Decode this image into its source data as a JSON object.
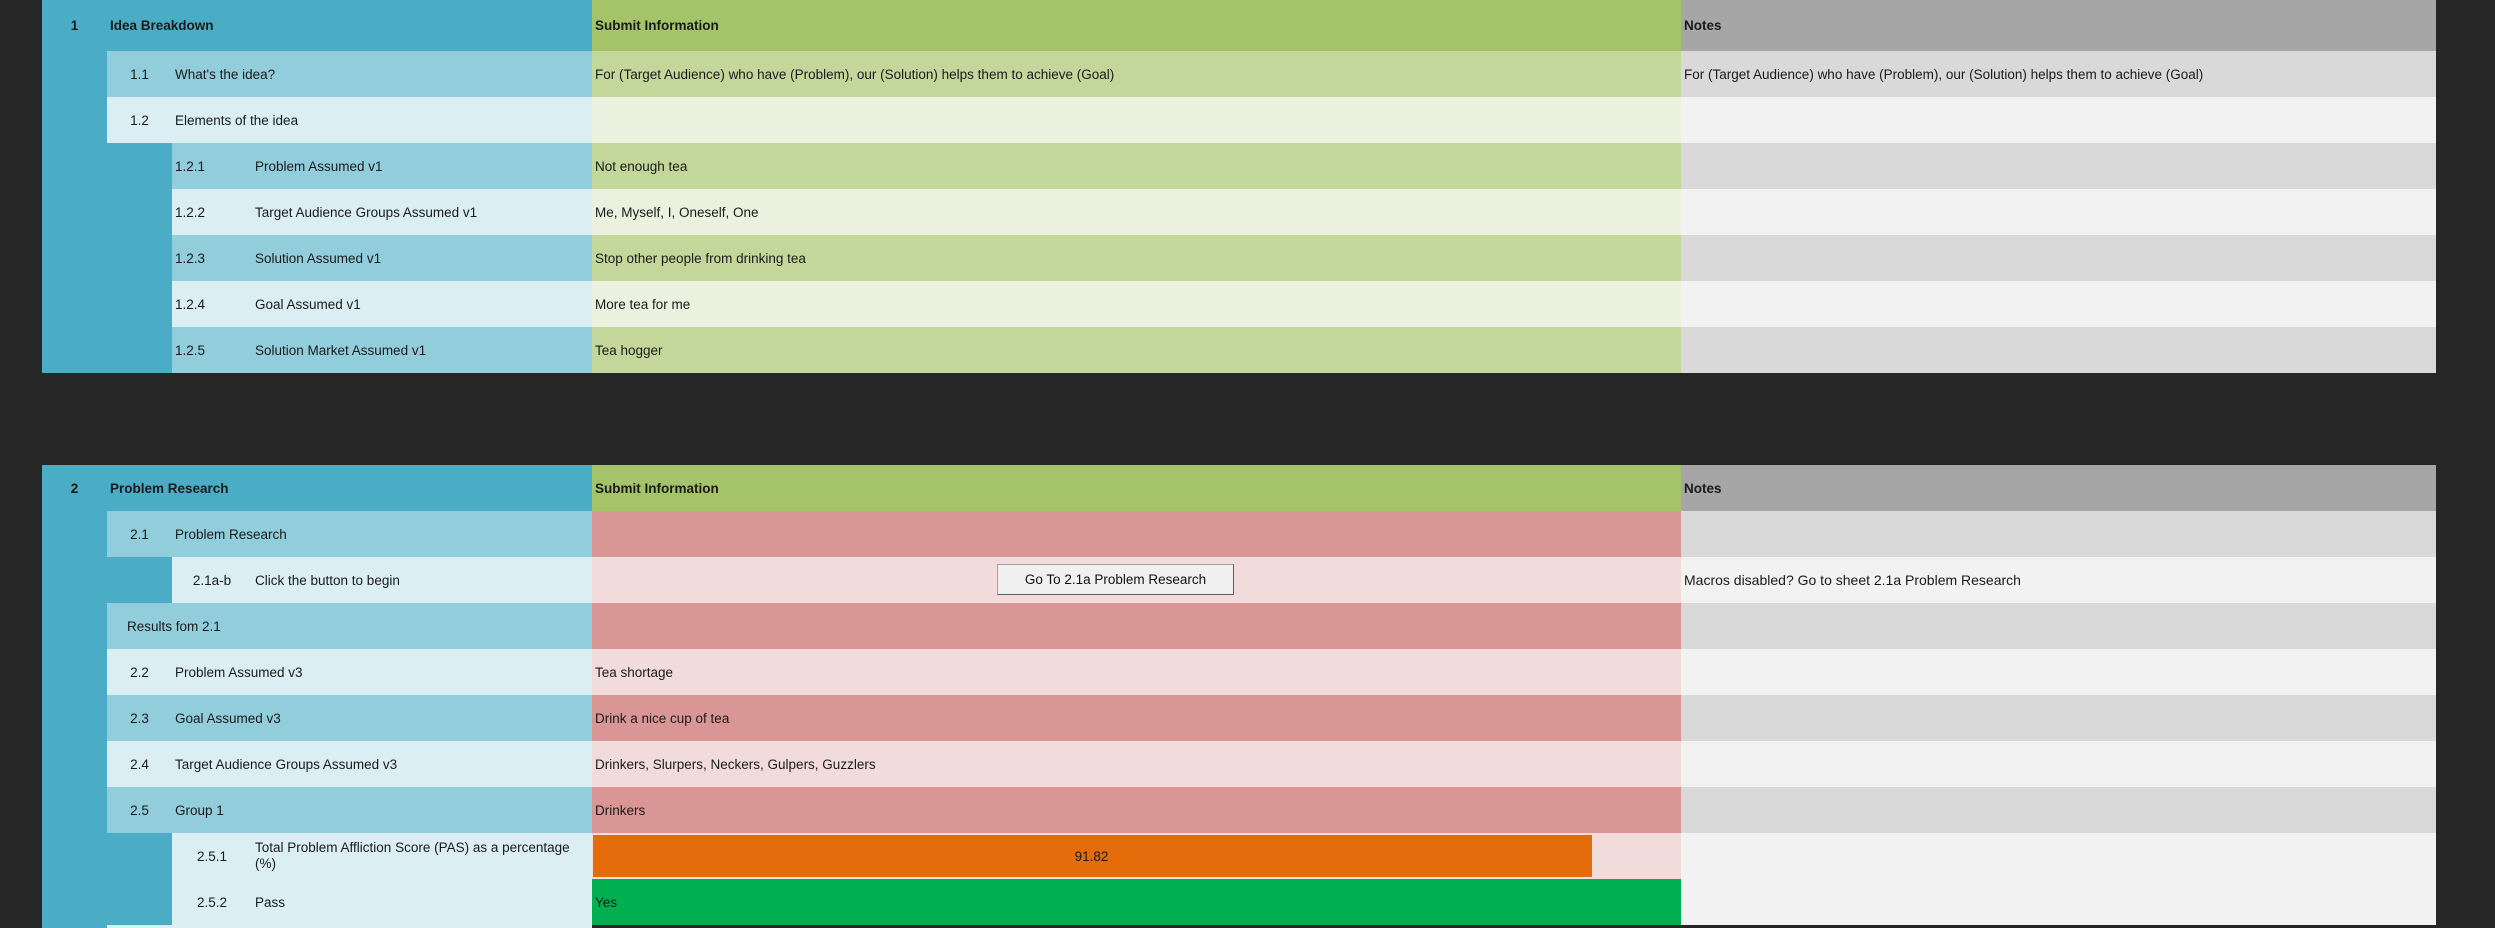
{
  "section1": {
    "number": "1",
    "title": "Idea Breakdown",
    "submit_header": "Submit Information",
    "notes_header": "Notes",
    "rows": [
      {
        "num": "1.1",
        "label": "What's the idea?",
        "value": "For (Target Audience) who have (Problem), our (Solution) helps them to achieve (Goal)",
        "note": "For (Target Audience) who have (Problem), our (Solution) helps them to achieve (Goal)"
      },
      {
        "num": "1.2",
        "label": "Elements of the idea",
        "value": "",
        "note": ""
      },
      {
        "num": "1.2.1",
        "label": "Problem Assumed v1",
        "value": "Not enough tea",
        "note": ""
      },
      {
        "num": "1.2.2",
        "label": "Target Audience Groups Assumed v1",
        "value": "Me, Myself, I, Oneself, One",
        "note": ""
      },
      {
        "num": "1.2.3",
        "label": "Solution Assumed v1",
        "value": "Stop other people from drinking tea",
        "note": ""
      },
      {
        "num": "1.2.4",
        "label": "Goal Assumed v1",
        "value": "More tea for me",
        "note": ""
      },
      {
        "num": "1.2.5",
        "label": "Solution Market Assumed v1",
        "value": "Tea hogger",
        "note": ""
      }
    ]
  },
  "section2": {
    "number": "2",
    "title": "Problem Research",
    "submit_header": "Submit Information",
    "notes_header": "Notes",
    "rows": [
      {
        "num": "2.1",
        "label": "Problem Research",
        "value": "",
        "note": ""
      },
      {
        "num": "2.1a-b",
        "label": "Click the button to begin",
        "value": "",
        "note": "Macros disabled? Go to sheet 2.1a Problem Research"
      },
      {
        "num": "",
        "label": "Results fom 2.1",
        "value": "",
        "note": ""
      },
      {
        "num": "2.2",
        "label": "Problem Assumed v3",
        "value": "Tea shortage",
        "note": ""
      },
      {
        "num": "2.3",
        "label": "Goal Assumed v3",
        "value": "Drink a nice cup of tea",
        "note": ""
      },
      {
        "num": "2.4",
        "label": "Target Audience Groups Assumed v3",
        "value": "Drinkers, Slurpers, Neckers, Gulpers, Guzzlers",
        "note": ""
      },
      {
        "num": "2.5",
        "label": "Group 1",
        "value": "Drinkers",
        "note": ""
      },
      {
        "num": "2.5.1",
        "label": "Total Problem Affliction Score (PAS) as a percentage (%)",
        "value": "91.82",
        "note": ""
      },
      {
        "num": "2.5.2",
        "label": "Pass",
        "value": "Yes",
        "note": ""
      }
    ],
    "button_label": "Go To 2.1a Problem Research",
    "pas_bar_fraction": 0.9182
  },
  "colors": {
    "pas_bar": "#e46c0a",
    "pass_yes": "#00b050"
  }
}
